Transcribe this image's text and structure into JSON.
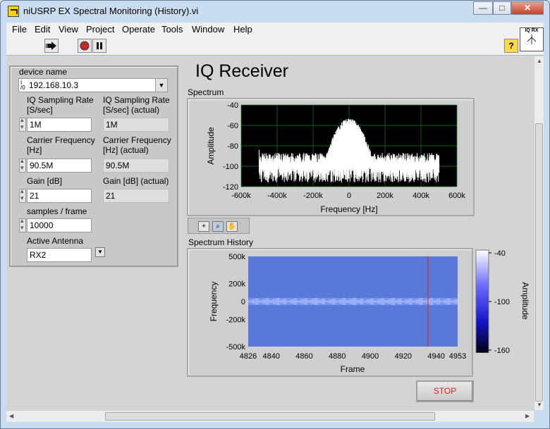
{
  "window": {
    "title": "niUSRP EX Spectral Monitoring (History).vi",
    "minimize": "—",
    "maximize": "□",
    "close": "✕"
  },
  "menu": [
    "File",
    "Edit",
    "View",
    "Project",
    "Operate",
    "Tools",
    "Window",
    "Help"
  ],
  "toolbar": {
    "run_icon": "run-arrow-icon",
    "abort_icon": "abort-icon",
    "pause_icon": "pause-icon",
    "help_label": "?",
    "connector_label": "IQ RX"
  },
  "controls": {
    "device_name_label": "device name",
    "device_name_value": "192.168.10.3",
    "iq_rate_label": "IQ Sampling Rate [S/sec]",
    "iq_rate_value": "1M",
    "iq_rate_actual_label": "IQ Sampling Rate [S/sec] (actual)",
    "iq_rate_actual_value": "1M",
    "carrier_label": "Carrier Frequency [Hz]",
    "carrier_value": "90.5M",
    "carrier_actual_label": "Carrier Frequency [Hz] (actual)",
    "carrier_actual_value": "90.5M",
    "gain_label": "Gain [dB]",
    "gain_value": "21",
    "gain_actual_label": "Gain [dB] (actual)",
    "gain_actual_value": "21",
    "samples_label": "samples / frame",
    "samples_value": "10000",
    "antenna_label": "Active Antenna",
    "antenna_value": "RX2"
  },
  "heading": "IQ Receiver",
  "spectrum": {
    "label": "Spectrum",
    "xlabel": "Frequency [Hz]",
    "ylabel": "Amplitude",
    "xticks": [
      "-600k",
      "-400k",
      "-200k",
      "0",
      "200k",
      "400k",
      "600k"
    ],
    "yticks": [
      "-40",
      "-60",
      "-80",
      "-100",
      "-120"
    ],
    "xlim": [
      -600000,
      600000
    ],
    "ylim": [
      -120,
      -40
    ],
    "plot_bg": "#000000",
    "grid_color": "#1f7a1f",
    "trace_color": "#ffffff",
    "noise_floor": -92,
    "band_edges": [
      -500000,
      500000
    ],
    "peak": -56
  },
  "history": {
    "label": "Spectrum History",
    "xlabel": "Frame",
    "ylabel": "Frequency",
    "xticks": [
      "4826",
      "4840",
      "4860",
      "4880",
      "4900",
      "4920",
      "4940",
      "4953"
    ],
    "yticks": [
      "500k",
      "200k",
      "0",
      "-200k",
      "-500k"
    ],
    "xlim": [
      4826,
      4953
    ],
    "ylim": [
      -500000,
      500000
    ],
    "cursor_frame": 4935,
    "cursor_color": "#e02020",
    "bg_color": "#5a78d8",
    "colorbar_label": "Amplitude",
    "colorbar_ticks": [
      "-40",
      "-100",
      "-160"
    ]
  },
  "palette": {
    "cursor_icon": "crosshair-icon",
    "zoom_icon": "zoom-icon",
    "pan_icon": "hand-icon"
  },
  "stop_label": "STOP"
}
